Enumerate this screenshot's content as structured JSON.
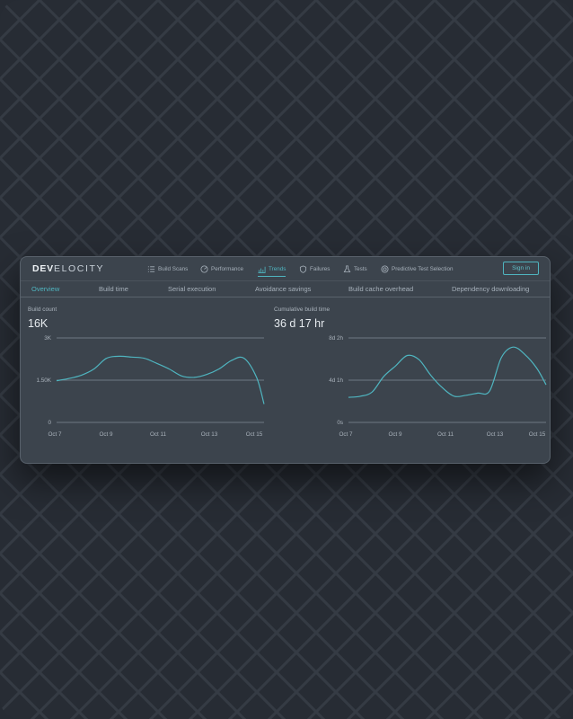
{
  "app": {
    "logo_prefix": "DEV",
    "logo_suffix": "ELOCITY",
    "nav": [
      {
        "label": "Build Scans",
        "icon": "list-icon",
        "active": false
      },
      {
        "label": "Performance",
        "icon": "gauge-icon",
        "active": false
      },
      {
        "label": "Trends",
        "icon": "bar-chart-icon",
        "active": true
      },
      {
        "label": "Failures",
        "icon": "shield-icon",
        "active": false
      },
      {
        "label": "Tests",
        "icon": "flask-icon",
        "active": false
      },
      {
        "label": "Predictive Test Selection",
        "icon": "target-icon",
        "active": false
      }
    ],
    "sign_in": "Sign in"
  },
  "tabs": [
    {
      "label": "Overview",
      "active": true
    },
    {
      "label": "Build time",
      "active": false
    },
    {
      "label": "Serial execution",
      "active": false
    },
    {
      "label": "Avoidance savings",
      "active": false
    },
    {
      "label": "Build cache overhead",
      "active": false
    },
    {
      "label": "Dependency downloading",
      "active": false
    }
  ],
  "metrics": [
    {
      "label": "Build count",
      "value": "16K"
    },
    {
      "label": "Cumulative build time",
      "value": "36 d 17 hr"
    }
  ],
  "colors": {
    "accent": "#4fb5c0",
    "panel": "#3c444d",
    "background": "#262b33"
  },
  "chart_data": [
    {
      "type": "line",
      "ylabel": "",
      "y_ticks": [
        "3K",
        "1.50K",
        "0"
      ],
      "ylim": [
        0,
        3000
      ],
      "x_ticks": [
        "Oct 7",
        "Oct 9",
        "Oct 11",
        "Oct 13",
        "Oct 15"
      ],
      "x": [
        7,
        7.5,
        8,
        8.5,
        9,
        9.5,
        10,
        10.5,
        11,
        11.5,
        12,
        12.5,
        13,
        13.5,
        14,
        14.5,
        15,
        15.3
      ],
      "values": [
        1480,
        1560,
        1680,
        1900,
        2280,
        2350,
        2320,
        2280,
        2100,
        1900,
        1650,
        1600,
        1700,
        1900,
        2200,
        2280,
        1600,
        650
      ]
    },
    {
      "type": "line",
      "ylabel": "",
      "y_ticks": [
        "8d 2h",
        "4d 1h",
        "0s"
      ],
      "ylim": [
        0,
        8.08
      ],
      "x_ticks": [
        "Oct 7",
        "Oct 9",
        "Oct 11",
        "Oct 13",
        "Oct 15"
      ],
      "x": [
        7,
        7.5,
        8,
        8.5,
        9,
        9.5,
        10,
        10.5,
        11,
        11.5,
        12,
        12.5,
        13,
        13.5,
        14,
        14.5,
        15,
        15.4
      ],
      "values": [
        2.4,
        2.5,
        2.9,
        4.4,
        5.4,
        6.4,
        6.0,
        4.5,
        3.3,
        2.5,
        2.6,
        2.8,
        3.0,
        6.2,
        7.2,
        6.5,
        5.2,
        3.6
      ]
    }
  ]
}
